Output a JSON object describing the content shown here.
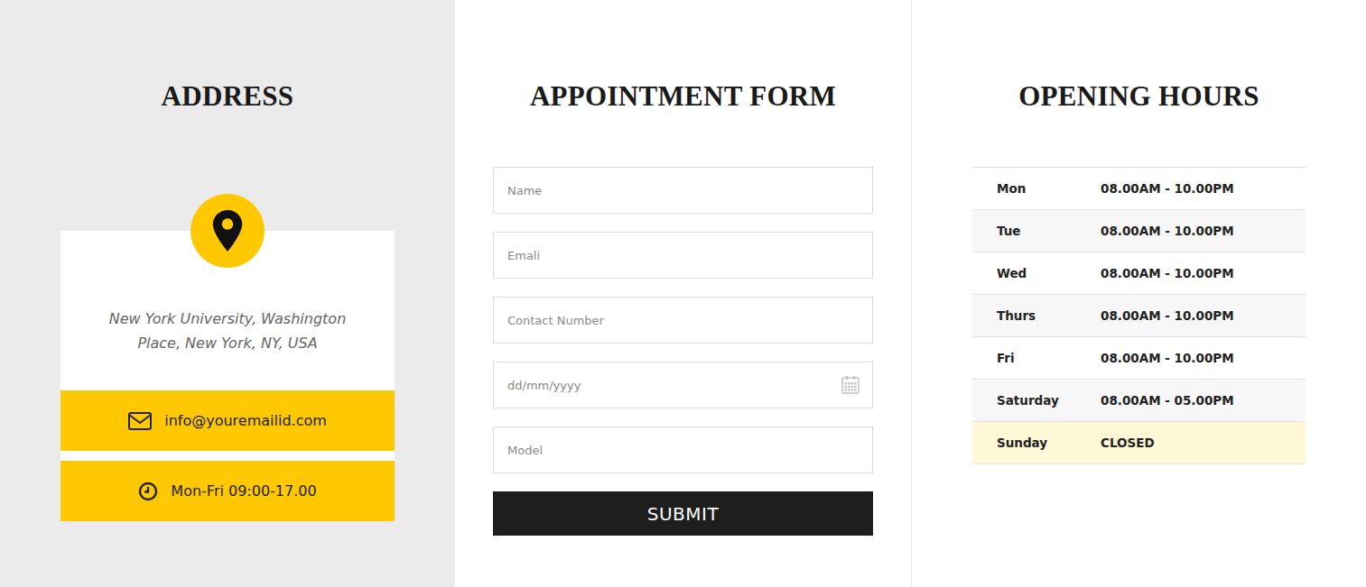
{
  "address": {
    "title": "ADDRESS",
    "lines": [
      "New York University, Washington",
      "Place, New York, NY, USA"
    ],
    "email": "info@youremailid.com",
    "hours": "Mon-Fri 09:00-17.00"
  },
  "form": {
    "title": "APPOINTMENT FORM",
    "fields": [
      {
        "placeholder": "Name",
        "kind": "text"
      },
      {
        "placeholder": "Emali",
        "kind": "text"
      },
      {
        "placeholder": "Contact Number",
        "kind": "text"
      },
      {
        "placeholder": "dd/mm/yyyy",
        "kind": "date"
      },
      {
        "placeholder": "Model",
        "kind": "text"
      }
    ],
    "submit": "SUBMIT"
  },
  "opening_hours": {
    "title": "OPENING HOURS",
    "rows": [
      {
        "day": "Mon",
        "time": "08.00AM - 10.00PM",
        "highlighted": false
      },
      {
        "day": "Tue",
        "time": "08.00AM - 10.00PM",
        "highlighted": false
      },
      {
        "day": "Wed",
        "time": "08.00AM - 10.00PM",
        "highlighted": false
      },
      {
        "day": "Thurs",
        "time": "08.00AM - 10.00PM",
        "highlighted": false
      },
      {
        "day": "Fri",
        "time": "08.00AM - 10.00PM",
        "highlighted": false
      },
      {
        "day": "Saturday",
        "time": "08.00AM - 05.00PM",
        "highlighted": false
      },
      {
        "day": "Sunday",
        "time": "CLOSED",
        "highlighted": true
      }
    ]
  }
}
